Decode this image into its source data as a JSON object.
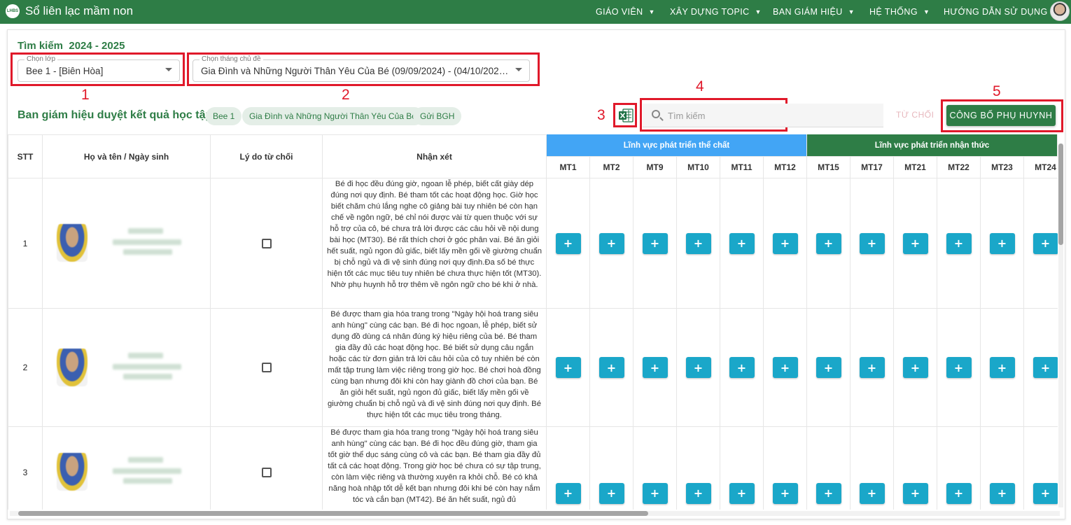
{
  "app": {
    "logo_text": "LHBS",
    "title": "Sổ liên lạc mầm non"
  },
  "nav": [
    {
      "label": "GIÁO VIÊN"
    },
    {
      "label": "XÂY DỰNG TOPIC"
    },
    {
      "label": "BAN GIÁM HIỆU"
    },
    {
      "label": "HỆ THỐNG"
    },
    {
      "label": "HƯỚNG DẪN SỬ DỤNG"
    }
  ],
  "filters": {
    "title": "Tìm kiếm  2024 - 2025",
    "class_label": "Chọn lớp",
    "class_value": "Bee 1 - [Biên Hòa]",
    "topic_label": "Chọn tháng chủ đề",
    "topic_value": "Gia Đình và Những Người Thân Yêu Của Bé (09/09/2024) - (04/10/2024) ..."
  },
  "annotations": [
    "1",
    "2",
    "3",
    "4",
    "5"
  ],
  "section": {
    "title": "Ban giám hiệu duyệt kết quả học tập",
    "chips": [
      "Bee 1",
      "Gia Đình và Những Người Thân Yêu Của Bé",
      "Gửi BGH"
    ],
    "search_placeholder": "Tìm kiếm",
    "reject_label": "TỪ CHỐI",
    "publish_label": "CÔNG BỐ PHỤ HUYNH"
  },
  "table": {
    "headers": {
      "stt": "STT",
      "name": "Họ và tên / Ngày sinh",
      "reason": "Lý do từ chối",
      "comment": "Nhận xét"
    },
    "groups": [
      {
        "label": "Lĩnh vực phát triển thể chất",
        "color": "#42a5f5"
      },
      {
        "label": "Lĩnh vực phát triển nhận thức",
        "color": "#2e7d46"
      }
    ],
    "criteria": [
      "MT1",
      "MT2",
      "MT9",
      "MT10",
      "MT11",
      "MT12",
      "MT15",
      "MT17",
      "MT21",
      "MT22",
      "MT23",
      "MT24"
    ],
    "plus_label": "+",
    "rows": [
      {
        "stt": "1",
        "comment": "Bé đi học đều đúng giờ, ngoan lễ phép, biết cất giày dép đúng nơi quy định. Bé tham tốt các hoạt động học. Giờ học biết chăm chú lắng nghe cô giảng bài tuy nhiên bé còn hạn chế về ngôn ngữ, bé chỉ nói được vài từ quen thuộc với sự hỗ trợ của cô, bé chưa trả lời được các câu hỏi về nội dung bài học (MT30). Bé rất thích chơi ở góc phân vai. Bé ăn giỏi hết suất, ngủ ngon đủ giấc, biết lấy mền gối về giường chuẩn bị chỗ ngủ và đi vệ sinh đúng nơi quy định.Đa số bé thực hiện tốt các mục tiêu tuy nhiên bé chưa thực hiện tốt (MT30). Nhờ phụ huynh hỗ trợ thêm về ngôn ngữ cho bé khi ở nhà."
      },
      {
        "stt": "2",
        "comment": "Bé được tham gia hóa trang trong \"Ngày hội hoá trang siêu anh hùng\" cùng các bạn. Bé đi học ngoan, lễ phép, biết sử dụng đồ dùng cá nhân đúng ký hiệu riêng của bé. Bé tham gia đầy đủ các hoạt động học. Bé biết sử dụng câu ngắn hoặc các từ đơn giản trả lời câu hỏi của cô tuy nhiên bé còn mất tập trung làm việc riêng trong giờ học. Bé chơi hoà đồng cùng bạn nhưng đôi khi còn hay giành đồ chơi của bạn. Bé ăn giỏi hết suất, ngủ ngon đủ giấc, biết lấy mền gối về giường chuẩn bị chỗ ngủ và đi vệ sinh đúng nơi quy định. Bé thực hiện tốt các mục tiêu trong tháng."
      },
      {
        "stt": "3",
        "comment": "Bé được tham gia hóa trang trong \"Ngày hội hoá trang siêu anh hùng\" cùng các bạn. Bé đi học đều đúng giờ, tham gia tốt giờ thể dục sáng cùng cô và các bạn. Bé tham gia đầy đủ tất cả các hoạt động. Trong giờ học bé chưa có sự tập trung, còn làm việc riêng và thường xuyên ra khỏi chỗ. Bé có khả năng hoà nhập tốt dễ kết bạn nhưng đôi khi bé còn hay nắm tóc và cắn bạn (MT42). Bé ăn hết suất, ngủ đủ"
      }
    ]
  }
}
